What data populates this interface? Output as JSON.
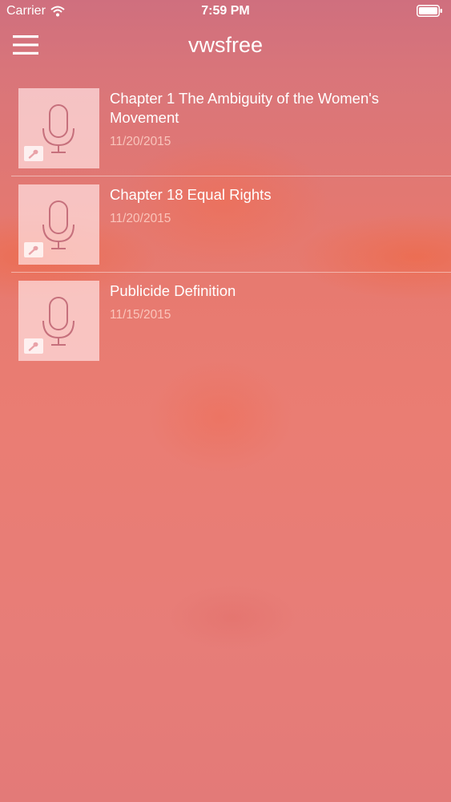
{
  "status_bar": {
    "carrier": "Carrier",
    "time": "7:59 PM",
    "icons": [
      "wifi-icon",
      "battery-icon"
    ]
  },
  "nav": {
    "title": "vwsfree",
    "menu_icon": "hamburger-menu-icon"
  },
  "recordings": [
    {
      "title": "Chapter 1 The Ambiguity of the Women's Movement",
      "date": "11/20/2015",
      "icon": "microphone-icon"
    },
    {
      "title": "Chapter 18 Equal Rights",
      "date": "11/20/2015",
      "icon": "microphone-icon"
    },
    {
      "title": "Publicide Definition",
      "date": "11/15/2015",
      "icon": "microphone-icon"
    }
  ],
  "colors": {
    "background_top": "#cf6f7e",
    "background_middle": "#ea7d73",
    "thumbnail": "#f8dcdc",
    "icon_stroke": "#c6707c",
    "text": "#ffffff",
    "date_text": "#ffd7cd"
  }
}
